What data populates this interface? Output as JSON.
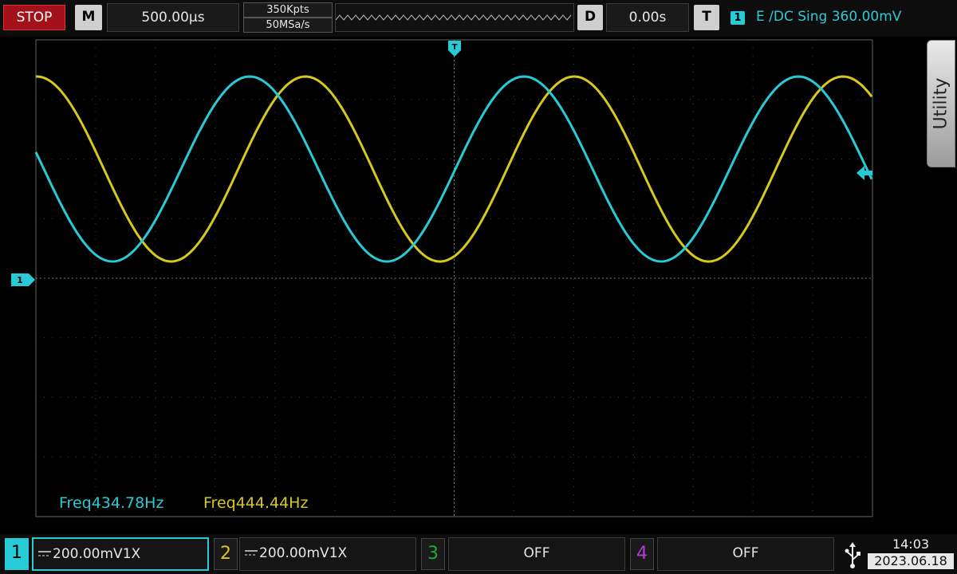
{
  "top": {
    "run_state": "STOP",
    "m_key": "M",
    "timebase": "500.00µs",
    "memory_depth": "350Kpts",
    "sample_rate": "50MSa/s",
    "d_key": "D",
    "delay": "0.00s",
    "t_key": "T",
    "trigger_channel": "1",
    "trigger_info": "E /DC Sing 360.00mV"
  },
  "side": {
    "utility_label": "Utility"
  },
  "markers": {
    "trigger_top": "T",
    "ch1_ground": "1"
  },
  "measurements": {
    "ch1_freq": "Freq434.78Hz",
    "ch2_freq": "Freq444.44Hz"
  },
  "channels": [
    {
      "number": "1",
      "coupling_icon": "dc-coupling-icon",
      "scale": "200.00mV",
      "probe": "1X",
      "color": "#27cbd6",
      "active": true
    },
    {
      "number": "2",
      "coupling_icon": "dc-coupling-icon",
      "scale": "200.00mV",
      "probe": "1X",
      "color": "#d8c81c"
    },
    {
      "number": "3",
      "state": "OFF",
      "color": "#1fa83c"
    },
    {
      "number": "4",
      "state": "OFF",
      "color": "#b43bd6"
    }
  ],
  "status": {
    "usb_icon": "usb-icon",
    "time": "14:03",
    "date": "2023.06.18"
  },
  "colors": {
    "ch1": "#27cbd6",
    "ch2": "#d8c81c",
    "stop_bg": "#a3121a"
  }
}
